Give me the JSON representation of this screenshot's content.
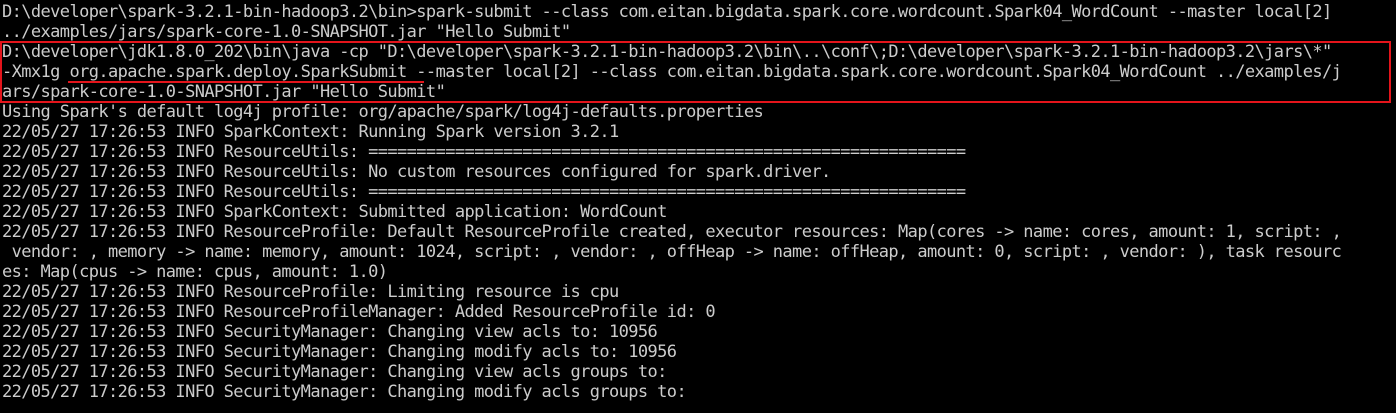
{
  "terminal": {
    "lines": [
      "D:\\developer\\spark-3.2.1-bin-hadoop3.2\\bin>spark-submit --class com.eitan.bigdata.spark.core.wordcount.Spark04_WordCount --master local[2]",
      "../examples/jars/spark-core-1.0-SNAPSHOT.jar \"Hello Submit\"",
      "D:\\developer\\jdk1.8.0_202\\bin\\java -cp \"D:\\developer\\spark-3.2.1-bin-hadoop3.2\\bin\\..\\conf\\;D:\\developer\\spark-3.2.1-bin-hadoop3.2\\jars\\*\"",
      "-Xmx1g org.apache.spark.deploy.SparkSubmit --master local[2] --class com.eitan.bigdata.spark.core.wordcount.Spark04_WordCount ../examples/j",
      "ars/spark-core-1.0-SNAPSHOT.jar \"Hello Submit\"",
      "Using Spark's default log4j profile: org/apache/spark/log4j-defaults.properties",
      "22/05/27 17:26:53 INFO SparkContext: Running Spark version 3.2.1",
      "22/05/27 17:26:53 INFO ResourceUtils: ==============================================================",
      "22/05/27 17:26:53 INFO ResourceUtils: No custom resources configured for spark.driver.",
      "22/05/27 17:26:53 INFO ResourceUtils: ==============================================================",
      "22/05/27 17:26:53 INFO SparkContext: Submitted application: WordCount",
      "22/05/27 17:26:53 INFO ResourceProfile: Default ResourceProfile created, executor resources: Map(cores -> name: cores, amount: 1, script: ,",
      " vendor: , memory -> name: memory, amount: 1024, script: , vendor: , offHeap -> name: offHeap, amount: 0, script: , vendor: ), task resourc",
      "es: Map(cpus -> name: cpus, amount: 1.0)",
      "22/05/27 17:26:53 INFO ResourceProfile: Limiting resource is cpu",
      "22/05/27 17:26:53 INFO ResourceProfileManager: Added ResourceProfile id: 0",
      "22/05/27 17:26:53 INFO SecurityManager: Changing view acls to: 10956",
      "22/05/27 17:26:53 INFO SecurityManager: Changing modify acls to: 10956",
      "22/05/27 17:26:53 INFO SecurityManager: Changing view acls groups to:",
      "22/05/27 17:26:53 INFO SecurityManager: Changing modify acls groups to:"
    ]
  },
  "colors": {
    "background": "#000000",
    "text": "#cccccc",
    "highlight": "#e4141b"
  }
}
